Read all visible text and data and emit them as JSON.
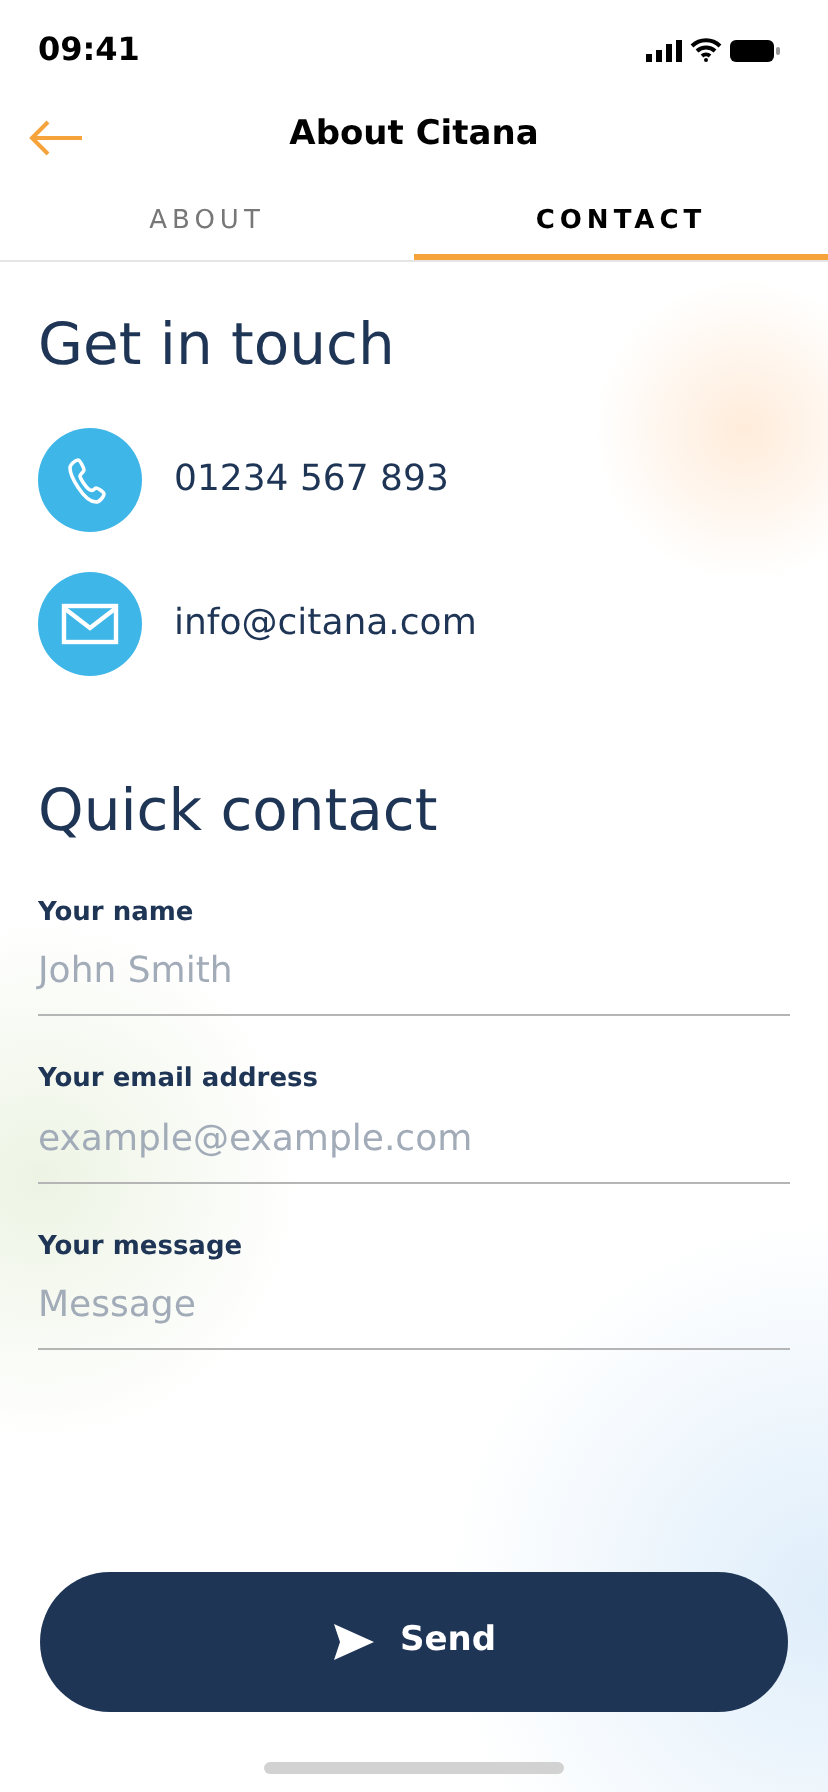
{
  "status_bar": {
    "time": "09:41"
  },
  "header": {
    "title": "About Citana"
  },
  "tabs": [
    {
      "label": "ABOUT",
      "selected": false
    },
    {
      "label": "CONTACT",
      "selected": true
    }
  ],
  "get_in_touch": {
    "heading": "Get in touch",
    "contacts": [
      {
        "kind": "phone",
        "text": "01234 567 893"
      },
      {
        "kind": "email",
        "text": "info@citana.com"
      }
    ]
  },
  "quick_contact": {
    "heading": "Quick contact",
    "fields": [
      {
        "label": "Your name",
        "placeholder": "John Smith"
      },
      {
        "label": "Your email address",
        "placeholder": "example@example.com"
      },
      {
        "label": "Your message",
        "placeholder": "Message"
      }
    ]
  },
  "send_button": {
    "label": "Send"
  }
}
